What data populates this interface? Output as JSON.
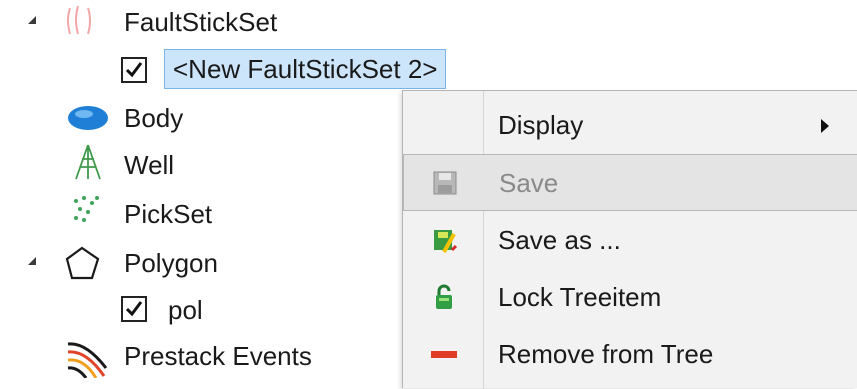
{
  "tree": {
    "items": [
      {
        "label": "FaultStickSet",
        "icon": "faultstickset-icon",
        "expanded": true
      },
      {
        "label": "<New FaultStickSet 2>",
        "checked": true,
        "selected": true
      },
      {
        "label": "Body",
        "icon": "body-icon"
      },
      {
        "label": "Well",
        "icon": "well-icon"
      },
      {
        "label": "PickSet",
        "icon": "pickset-icon"
      },
      {
        "label": "Polygon",
        "icon": "polygon-icon",
        "expanded": true
      },
      {
        "label": "pol",
        "checked": true
      },
      {
        "label": "Prestack Events",
        "icon": "prestack-events-icon"
      }
    ]
  },
  "context_menu": {
    "items": [
      {
        "label": "Display",
        "icon": "",
        "submenu": true
      },
      {
        "label": "Save",
        "icon": "floppy-disk-icon",
        "disabled": true,
        "highlighted": true
      },
      {
        "label": "Save as ...",
        "icon": "save-as-icon"
      },
      {
        "label": "Lock Treeitem",
        "icon": "padlock-icon"
      },
      {
        "label": "Remove from Tree",
        "icon": "remove-icon"
      }
    ]
  },
  "colors": {
    "selection_bg": "#cce5fb",
    "selection_border": "#7db4e8",
    "menu_bg": "#f2f2f2",
    "menu_hover": "#e4e4e4",
    "disabled_text": "#8a8a8a"
  }
}
